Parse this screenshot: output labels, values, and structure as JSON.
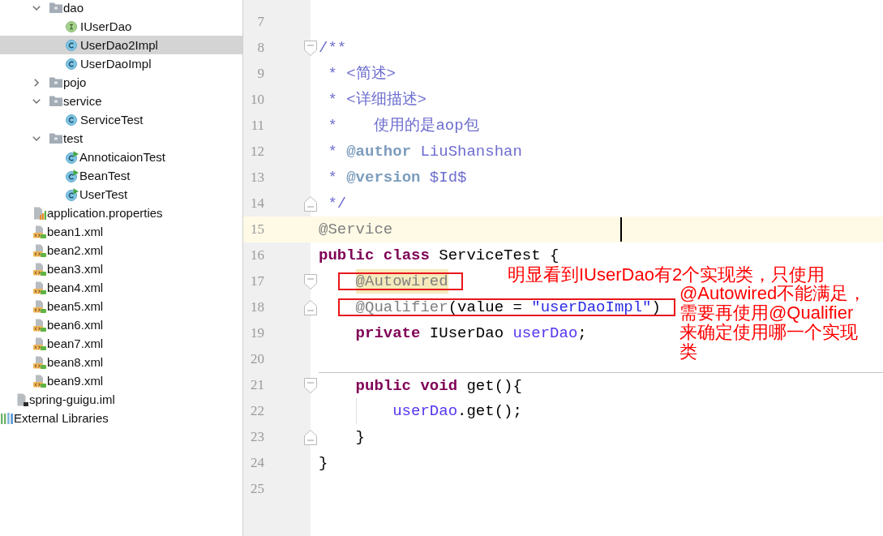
{
  "project_tree": [
    {
      "children": [
        {
          "children": [
            {
              "children": [
                {
                  "label": "dao",
                  "kind": "folder",
                  "expanded": true,
                  "selected": false,
                  "children": [
                    {
                      "label": "IUserDao",
                      "kind": "interface",
                      "selected": false
                    },
                    {
                      "label": "UserDao2Impl",
                      "kind": "class",
                      "selected": true
                    },
                    {
                      "label": "UserDaoImpl",
                      "kind": "class",
                      "selected": false
                    }
                  ]
                },
                {
                  "label": "pojo",
                  "kind": "folder",
                  "expanded": false,
                  "selected": false
                },
                {
                  "label": "service",
                  "kind": "folder",
                  "expanded": true,
                  "selected": false,
                  "children": [
                    {
                      "label": "ServiceTest",
                      "kind": "class",
                      "selected": false
                    }
                  ]
                },
                {
                  "label": "test",
                  "kind": "folder",
                  "expanded": true,
                  "selected": false,
                  "children": [
                    {
                      "label": "AnnoticaionTest",
                      "kind": "test_class",
                      "selected": false
                    },
                    {
                      "label": "BeanTest",
                      "kind": "test_class",
                      "selected": false
                    },
                    {
                      "label": "UserTest",
                      "kind": "test_class",
                      "selected": false
                    }
                  ]
                }
              ]
            },
            {
              "label": "application.properties",
              "kind": "properties",
              "selected": false
            },
            {
              "label": "bean1.xml",
              "kind": "xml",
              "selected": false
            },
            {
              "label": "bean2.xml",
              "kind": "xml",
              "selected": false
            },
            {
              "label": "bean3.xml",
              "kind": "xml",
              "selected": false
            },
            {
              "label": "bean4.xml",
              "kind": "xml",
              "selected": false
            },
            {
              "label": "bean5.xml",
              "kind": "xml",
              "selected": false
            },
            {
              "label": "bean6.xml",
              "kind": "xml",
              "selected": false
            },
            {
              "label": "bean7.xml",
              "kind": "xml",
              "selected": false
            },
            {
              "label": "bean8.xml",
              "kind": "xml",
              "selected": false
            },
            {
              "label": "bean9.xml",
              "kind": "xml",
              "selected": false
            }
          ]
        },
        {
          "label": "spring-guigu.iml",
          "kind": "module_file",
          "selected": false
        }
      ]
    },
    {
      "label": "External Libraries",
      "kind": "libraries",
      "selected": false
    }
  ],
  "editor": {
    "lines": [
      {
        "number": "7",
        "current": false
      },
      {
        "number": "8",
        "current": false,
        "fold_start": true,
        "tokens": [
          {
            "text": "/**",
            "kind": "doc"
          }
        ]
      },
      {
        "number": "9",
        "current": false,
        "tokens": [
          {
            "text": " * <简述>",
            "kind": "doc"
          }
        ]
      },
      {
        "number": "10",
        "current": false,
        "tokens": [
          {
            "text": " * <详细描述>",
            "kind": "doc"
          }
        ]
      },
      {
        "number": "11",
        "current": false,
        "tokens": [
          {
            "text": " *    使用的是aop包",
            "kind": "doc"
          }
        ]
      },
      {
        "number": "12",
        "current": false,
        "tokens": [
          {
            "text": " * ",
            "kind": "doc"
          },
          {
            "text": "@author",
            "kind": "doc_tag"
          },
          {
            "text": " LiuShanshan",
            "kind": "doc"
          }
        ]
      },
      {
        "number": "13",
        "current": false,
        "tokens": [
          {
            "text": " * ",
            "kind": "doc"
          },
          {
            "text": "@version",
            "kind": "doc_tag"
          },
          {
            "text": " $Id$",
            "kind": "doc"
          }
        ]
      },
      {
        "number": "14",
        "current": false,
        "fold_end": true,
        "tokens": [
          {
            "text": " */",
            "kind": "doc"
          }
        ]
      },
      {
        "number": "15",
        "current": true,
        "tokens": [
          {
            "text": "@Service",
            "kind": "annotation"
          }
        ]
      },
      {
        "number": "16",
        "current": false,
        "tokens": [
          {
            "text": "public",
            "kind": "keyword"
          },
          {
            "text": " class",
            "kind": "keyword"
          },
          {
            "text": " ServiceTest {",
            "kind": "plain"
          }
        ]
      },
      {
        "number": "17",
        "current": false,
        "fold_start": true,
        "marked": true,
        "usage_highlight": true,
        "tokens": [
          {
            "text": "    @Autowired",
            "kind": "annotation"
          }
        ]
      },
      {
        "number": "18",
        "current": false,
        "fold_end": true,
        "marked": true,
        "tokens": [
          {
            "text": "    @Qualifier",
            "kind": "annotation"
          },
          {
            "text": "(value = ",
            "kind": "plain"
          },
          {
            "text": "\"userDaoImpl\"",
            "kind": "string"
          },
          {
            "text": ")",
            "kind": "plain"
          }
        ]
      },
      {
        "number": "19",
        "current": false,
        "tokens": [
          {
            "text": "    private",
            "kind": "keyword"
          },
          {
            "text": " IUserDao ",
            "kind": "plain"
          },
          {
            "text": "userDao",
            "kind": "field"
          },
          {
            "text": ";",
            "kind": "plain"
          }
        ]
      },
      {
        "number": "20",
        "current": false
      },
      {
        "number": "21",
        "current": false,
        "fold_start": true,
        "separator": true,
        "tokens": [
          {
            "text": "    public",
            "kind": "keyword"
          },
          {
            "text": " void",
            "kind": "keyword"
          },
          {
            "text": " get(){",
            "kind": "plain"
          }
        ]
      },
      {
        "number": "22",
        "current": false,
        "indent_guide": true,
        "tokens": [
          {
            "text": "        userDao",
            "kind": "field"
          },
          {
            "text": ".get();",
            "kind": "plain"
          }
        ]
      },
      {
        "number": "23",
        "current": false,
        "fold_end": true,
        "tokens": [
          {
            "text": "    }",
            "kind": "plain"
          }
        ]
      },
      {
        "number": "24",
        "current": false,
        "tokens": [
          {
            "text": "}",
            "kind": "plain"
          }
        ]
      },
      {
        "number": "25",
        "current": false
      }
    ]
  },
  "annotations": [
    {
      "text": "明显看到IUserDao有2个实现类，只使用"
    },
    {
      "text": "@Autowired不能满足，需要再使用@Qualifier来确定使用哪一个实现类"
    }
  ]
}
